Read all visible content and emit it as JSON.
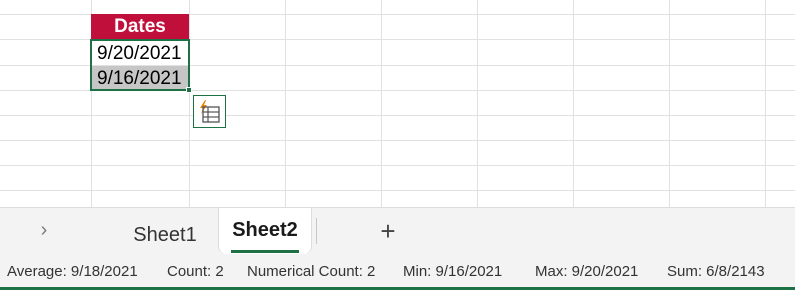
{
  "sheet": {
    "header_cell": "Dates",
    "cells": [
      "9/20/2021",
      "9/16/2021"
    ],
    "header_color": "#c00f3a",
    "selection_color": "#1e7145"
  },
  "quick_analysis_icon": "quick-analysis-icon",
  "tabs": {
    "nav_next": "›",
    "sheets": [
      "Sheet1",
      "Sheet2"
    ],
    "active": "Sheet2",
    "add_label": "+"
  },
  "status": {
    "average": "Average: 9/18/2021",
    "count": "Count: 2",
    "numerical_count": "Numerical Count: 2",
    "min": "Min: 9/16/2021",
    "max": "Max: 9/20/2021",
    "sum": "Sum: 6/8/2143"
  }
}
